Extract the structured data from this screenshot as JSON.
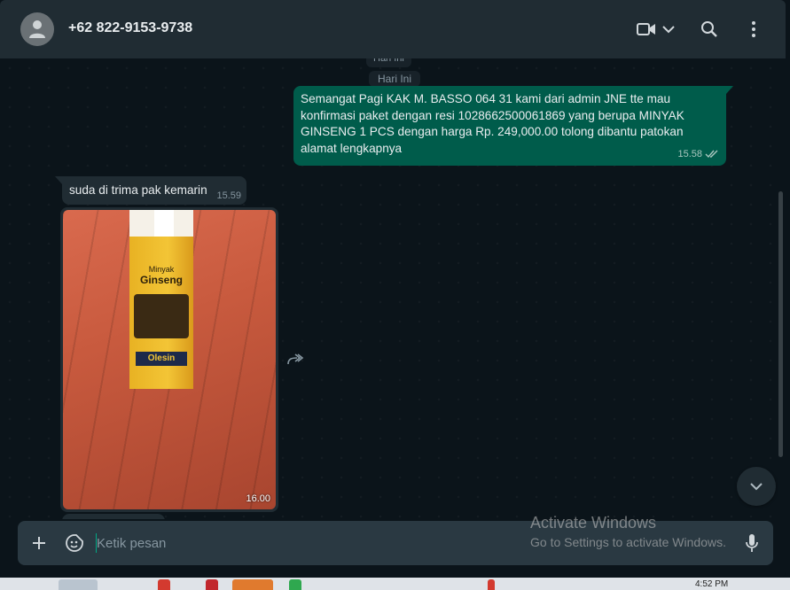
{
  "header": {
    "contact_name": "+62 822-9153-9738",
    "icons": [
      "avatar-person-icon",
      "video-call-icon",
      "chevron-down-icon",
      "search-icon",
      "menu-dots-icon"
    ]
  },
  "chat": {
    "date_label": "Hari Ini",
    "date_label_ghost": "Hari Ini",
    "messages": [
      {
        "direction": "outgoing",
        "text": "Semangat Pagi KAK M. BASSO 064 31 kami dari admin JNE tte mau konfirmasi paket dengan resi 1028662500061869 yang berupa MINYAK GINSENG 1 PCS dengan harga Rp. 249,000.00 tolong dibantu patokan alamat lengkapnya",
        "time": "15.58",
        "status": "delivered-double-check-icon"
      },
      {
        "direction": "incoming",
        "text": "suda di trima pak kemarin",
        "time": "15.59"
      },
      {
        "direction": "incoming",
        "type": "image",
        "product": {
          "line1": "Minyak",
          "line2": "Ginseng",
          "brand": "Olesin"
        },
        "time": "16.00"
      }
    ]
  },
  "composer": {
    "placeholder": "Ketik pesan",
    "icons": [
      "plus-icon",
      "sticker-icon",
      "microphone-icon"
    ]
  },
  "watermark": {
    "title": "Activate Windows",
    "subtitle": "Go to Settings to activate Windows."
  },
  "taskbar": {
    "clock": "4:52 PM"
  },
  "colors": {
    "header_bg": "#202c33",
    "chat_bg": "#0b141a",
    "outgoing_bubble": "#005c4b",
    "incoming_bubble": "#202c33",
    "accent": "#00a884"
  }
}
